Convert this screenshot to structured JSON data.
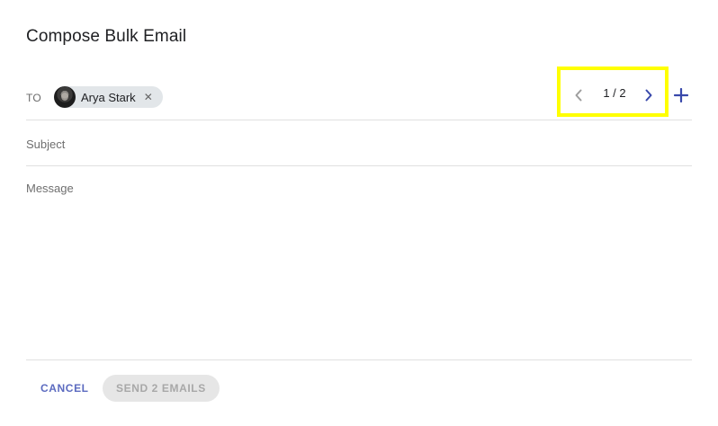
{
  "dialog": {
    "title": "Compose Bulk Email"
  },
  "recipients": {
    "to_label": "TO",
    "chips": [
      {
        "name": "Arya Stark",
        "avatar_icon": "user-avatar",
        "remove_icon": "close-icon"
      }
    ]
  },
  "pager": {
    "count": "1 / 2",
    "prev_icon": "chevron-left-icon",
    "next_icon": "chevron-right-icon",
    "add_icon": "plus-icon",
    "prev_color": "#9e9e9e",
    "next_color": "#3949ab",
    "add_color": "#3949ab",
    "highlight_color": "#ffff00"
  },
  "fields": {
    "subject_placeholder": "Subject",
    "subject_value": "",
    "message_placeholder": "Message",
    "message_value": ""
  },
  "footer": {
    "cancel_label": "CANCEL",
    "send_label": "SEND 2 EMAILS",
    "cancel_color": "#5c6bc0"
  }
}
